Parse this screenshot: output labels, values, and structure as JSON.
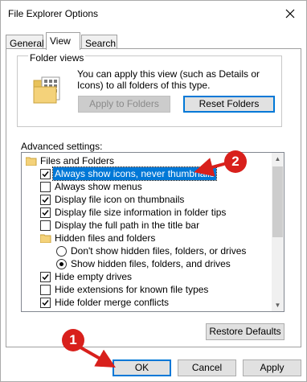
{
  "window": {
    "title": "File Explorer Options"
  },
  "tabs": [
    {
      "label": "General"
    },
    {
      "label": "View"
    },
    {
      "label": "Search"
    }
  ],
  "folder_views": {
    "title": "Folder views",
    "description": "You can apply this view (such as Details or Icons) to all folders of this type.",
    "apply_button": "Apply to Folders",
    "reset_button": "Reset Folders"
  },
  "advanced": {
    "label": "Advanced settings:",
    "items": [
      {
        "label": "Files and Folders",
        "kind": "folder"
      },
      {
        "label": "Always show icons, never thumbnails",
        "kind": "checkbox",
        "checked": true,
        "selected": true
      },
      {
        "label": "Always show menus",
        "kind": "checkbox",
        "checked": false
      },
      {
        "label": "Display file icon on thumbnails",
        "kind": "checkbox",
        "checked": true
      },
      {
        "label": "Display file size information in folder tips",
        "kind": "checkbox",
        "checked": true
      },
      {
        "label": "Display the full path in the title bar",
        "kind": "checkbox",
        "checked": false
      },
      {
        "label": "Hidden files and folders",
        "kind": "folder"
      },
      {
        "label": "Don't show hidden files, folders, or drives",
        "kind": "radio",
        "checked": false
      },
      {
        "label": "Show hidden files, folders, and drives",
        "kind": "radio",
        "checked": true
      },
      {
        "label": "Hide empty drives",
        "kind": "checkbox",
        "checked": true
      },
      {
        "label": "Hide extensions for known file types",
        "kind": "checkbox",
        "checked": false
      },
      {
        "label": "Hide folder merge conflicts",
        "kind": "checkbox",
        "checked": true
      }
    ],
    "restore_button": "Restore Defaults"
  },
  "footer": {
    "ok": "OK",
    "cancel": "Cancel",
    "apply": "Apply"
  },
  "annotations": {
    "badge1": "1",
    "badge2": "2"
  },
  "colors": {
    "accent": "#0078d7",
    "annotation": "#d8201c"
  },
  "icons": {
    "close": "close-icon",
    "folder": "folder-icon"
  }
}
